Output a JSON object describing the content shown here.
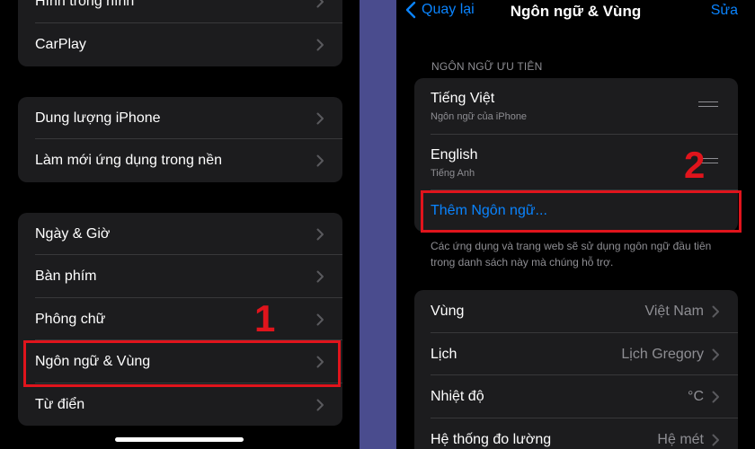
{
  "left": {
    "group1": [
      {
        "label": "Hình trong hình"
      },
      {
        "label": "CarPlay"
      }
    ],
    "group2": [
      {
        "label": "Dung lượng iPhone"
      },
      {
        "label": "Làm mới ứng dụng trong nền"
      }
    ],
    "group3": [
      {
        "label": "Ngày & Giờ"
      },
      {
        "label": "Bàn phím"
      },
      {
        "label": "Phông chữ"
      },
      {
        "label": "Ngôn ngữ & Vùng"
      },
      {
        "label": "Từ điển"
      }
    ],
    "step_marker": "1"
  },
  "right": {
    "nav": {
      "back_label": "Quay lại",
      "title": "Ngôn ngữ & Vùng",
      "edit_label": "Sửa"
    },
    "section_header": "NGÔN NGỮ ƯU TIÊN",
    "languages": [
      {
        "name": "Tiếng Việt",
        "subtitle": "Ngôn ngữ của iPhone"
      },
      {
        "name": "English",
        "subtitle": "Tiếng Anh"
      }
    ],
    "add_language": "Thêm Ngôn ngữ...",
    "footer_note": "Các ứng dụng và trang web sẽ sử dụng ngôn ngữ đầu tiên trong danh sách này mà chúng hỗ trợ.",
    "region_settings": [
      {
        "label": "Vùng",
        "value": "Việt Nam"
      },
      {
        "label": "Lịch",
        "value": "Lịch Gregory"
      },
      {
        "label": "Nhiệt độ",
        "value": "°C"
      },
      {
        "label": "Hệ thống đo lường",
        "value": "Hệ mét"
      }
    ],
    "step_marker": "2"
  },
  "colors": {
    "accent": "#0a84ff",
    "highlight": "#e0141c",
    "cell": "#1c1c1e",
    "divider": "#4a4c8e"
  },
  "icons": [
    "chevron-right-icon",
    "chevron-left-icon",
    "drag-handle-icon"
  ]
}
